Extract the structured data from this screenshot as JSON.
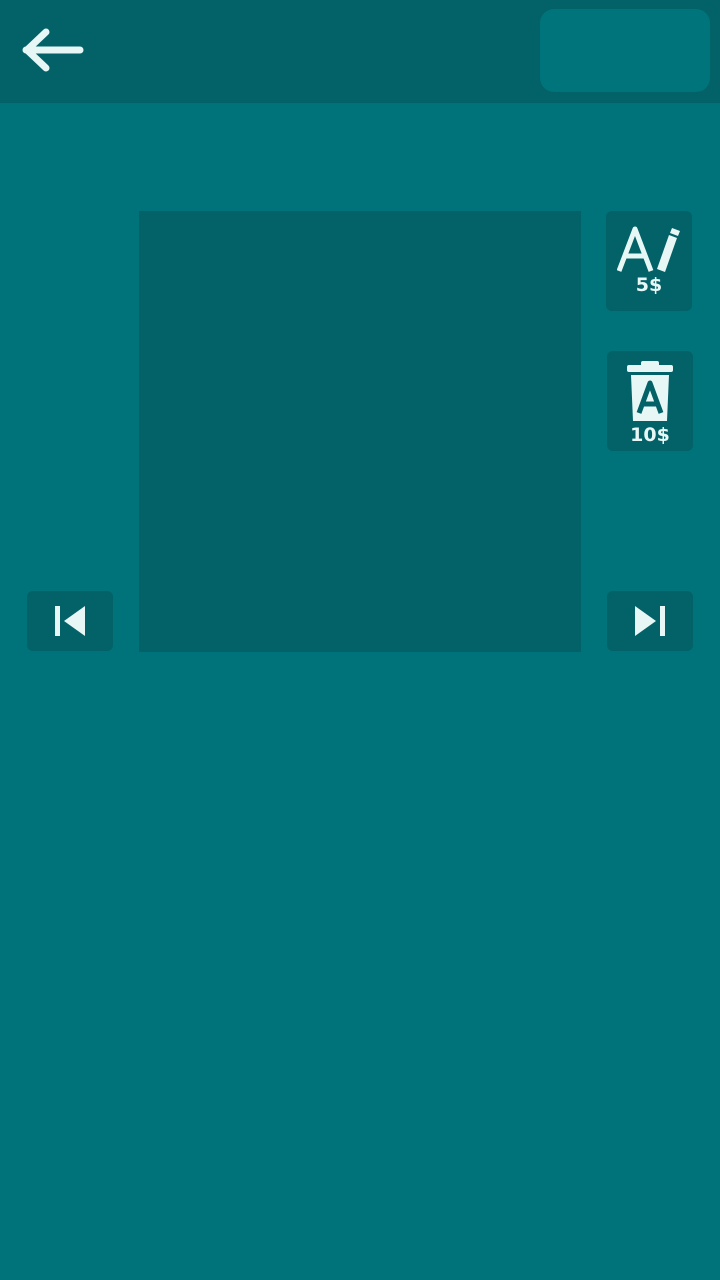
{
  "header": {
    "back_icon": "arrow-left-icon",
    "coin_panel_text": ""
  },
  "tools": {
    "hint": {
      "icon": "letter-a-pencil-icon",
      "price": "5$"
    },
    "remove": {
      "icon": "trash-letter-a-icon",
      "price": "10$"
    }
  },
  "navigation": {
    "prev_icon": "skip-previous-icon",
    "next_icon": "skip-next-icon"
  },
  "colors": {
    "background": "#007279",
    "panel": "#036168",
    "icon": "#e6f7f6"
  }
}
